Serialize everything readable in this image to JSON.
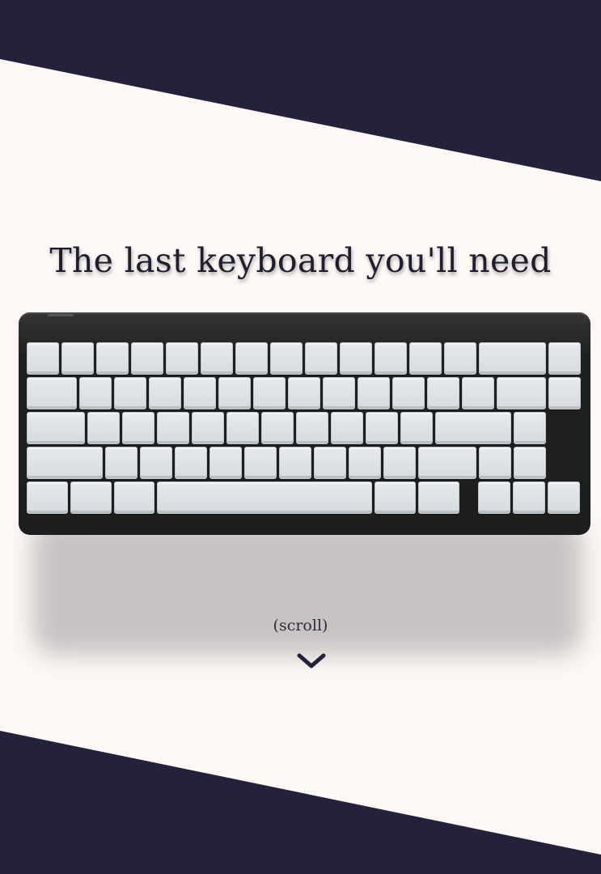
{
  "hero": {
    "headline": "The last keyboard you'll need",
    "scroll_hint": "(scroll)"
  },
  "keyboard": {
    "rows": [
      [
        1,
        1,
        1,
        1,
        1,
        1,
        1,
        1,
        1,
        1,
        1,
        1,
        1,
        2,
        1
      ],
      [
        1.5,
        1,
        1,
        1,
        1,
        1,
        1,
        1,
        1,
        1,
        1,
        1,
        1,
        1.5,
        1
      ],
      [
        1.75,
        1,
        1,
        1,
        1,
        1,
        1,
        1,
        1,
        1,
        1,
        2.25,
        1
      ],
      [
        2.25,
        1,
        1,
        1,
        1,
        1,
        1,
        1,
        1,
        1,
        1.75,
        1,
        1
      ],
      [
        1.25,
        1.25,
        1.25,
        6.25,
        1.25,
        1.25,
        "gap",
        1,
        1,
        1
      ]
    ]
  },
  "colors": {
    "background": "#23223a",
    "hero": "#fdf8f6",
    "keycap": "#dde2e5",
    "case": "#1e1e1e"
  }
}
